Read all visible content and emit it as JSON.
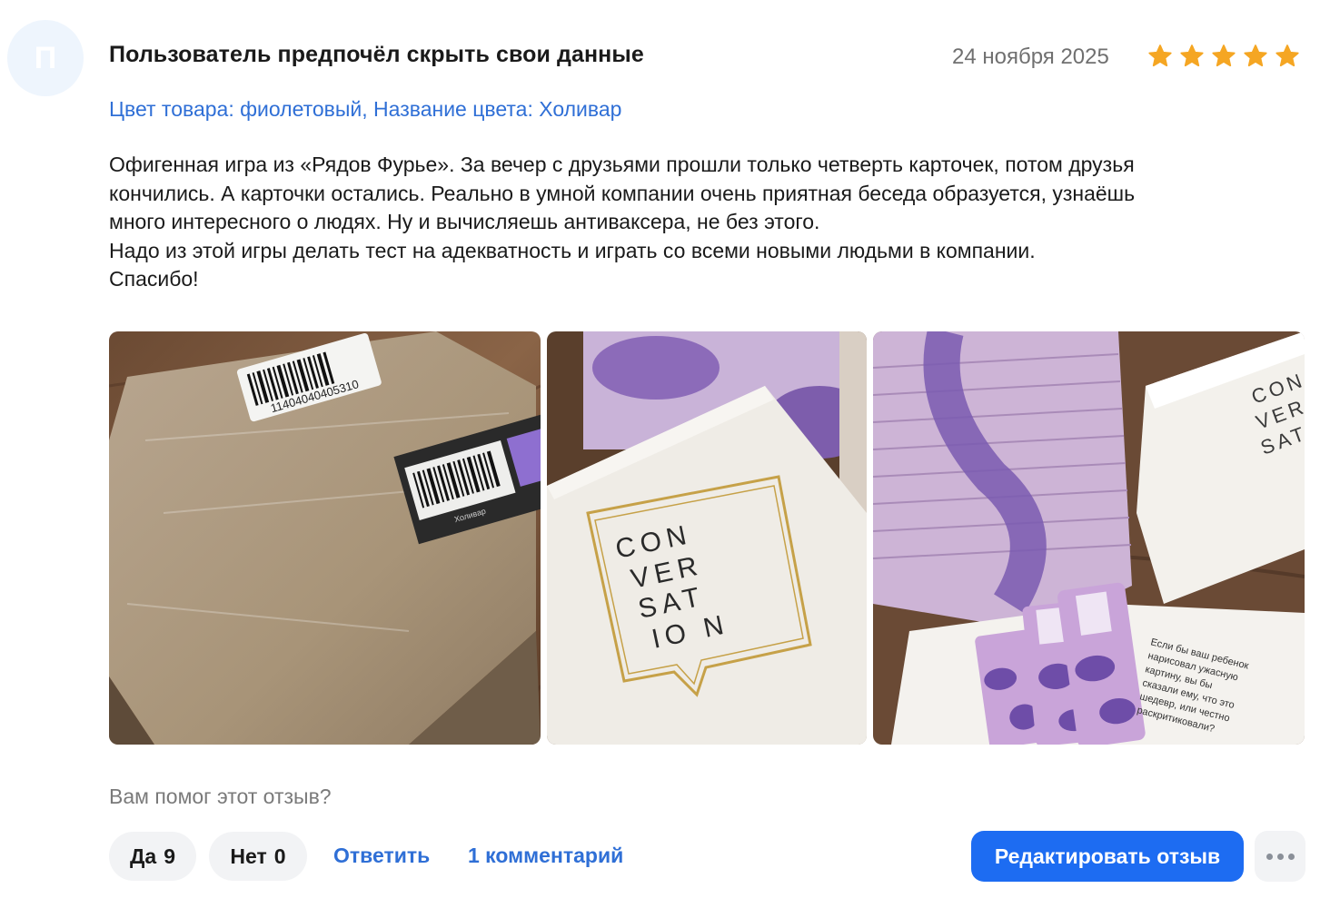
{
  "review": {
    "avatar_letter": "П",
    "author": "Пользователь предпочёл скрыть свои данные",
    "date": "24 ноября 2025",
    "rating": 5,
    "star_color": "#f5a623",
    "variant": "Цвет товара: фиолетовый, Название цвета: Холивар",
    "text_lines": [
      "Офигенная игра из «Рядов Фурье». За вечер с друзьями прошли только четверть карточек, потом друзья",
      "кончились. А карточки остались. Реально в умной компании очень приятная беседа образуется, узнаёшь",
      "много интересного о людях. Ну и вычисляешь антиваксера, не без этого.",
      "Надо из этой игры делать тест на адекватность и играть со всеми новыми людьми в компании.",
      "Спасибо!"
    ],
    "photos": [
      {
        "label": "photo-package",
        "barcode_text": "11404040405310",
        "small_label_text": "Холивар"
      },
      {
        "label": "photo-box",
        "box_title": "CON VER SAT IO N"
      },
      {
        "label": "photo-cards",
        "box_title": "CON VER SAT",
        "card_text": [
          "Если бы ваш ребенок",
          "нарисовал ужасную",
          "картину, вы бы",
          "сказали ему, что это",
          "шедевр, или честно",
          "раскритиковали?"
        ]
      }
    ]
  },
  "feedback": {
    "question": "Вам помог этот отзыв?",
    "yes_label": "Да",
    "yes_count": "9",
    "no_label": "Нет",
    "no_count": "0",
    "reply_label": "Ответить",
    "comments_label": "1 комментарий",
    "edit_label": "Редактировать отзыв",
    "more_icon": "more-dots-icon"
  },
  "colors": {
    "link": "#2f6fd6",
    "primary_button": "#1d6cf2",
    "muted_text": "#7a7a7a"
  }
}
